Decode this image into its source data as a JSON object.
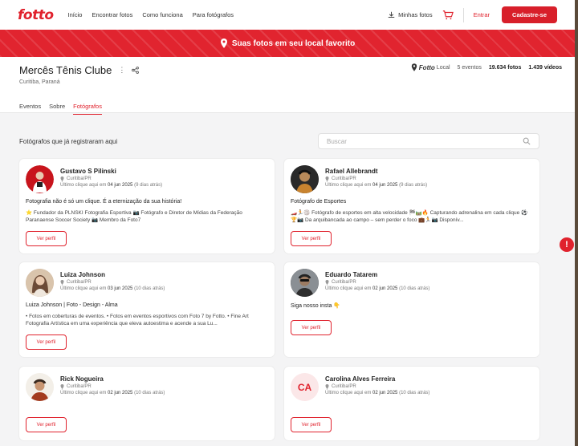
{
  "nav": {
    "logo": "fotto",
    "links": [
      "Início",
      "Encontrar fotos",
      "Como funciona",
      "Para fotógrafos"
    ],
    "my_photos": "Minhas fotos",
    "login": "Entrar",
    "signup": "Cadastre-se"
  },
  "banner": {
    "text": "Suas fotos em seu local favorito"
  },
  "venue": {
    "name": "Mercês Tênis Clube",
    "location": "Curitiba, Paraná",
    "brand": "Fotto",
    "brand_suffix": "Local",
    "events": "5 eventos",
    "photos": "19.634 fotos",
    "videos": "1.439 vídeos"
  },
  "tabs": [
    "Eventos",
    "Sobre",
    "Fotógrafos"
  ],
  "active_tab": "Fotógrafos",
  "section": {
    "title": "Fotógrafos que já registraram aqui",
    "search_placeholder": "Buscar"
  },
  "photographers": [
    {
      "name": "Gustavo S Pilinski",
      "city": "Curitiba/PR",
      "last_click_prefix": "Último clique aqui em",
      "last_click_date": "04 jun 2025",
      "last_click_ago": "(9 dias atrás)",
      "headline": "Fotografia não é só um clique. É a eternização da sua história!",
      "bio": "⭐ Fundador da PLNSKI Fotografia Esportiva 📷 Fotógrafo e Diretor de Mídias da Federação Paranaense Soccer Society 📷 Membro da Foto7",
      "button": "Ver perfil",
      "avatar_colors": [
        "#c8141c",
        "#f2f2f2"
      ]
    },
    {
      "name": "Rafael Allebrandt",
      "city": "Curitiba/PR",
      "last_click_prefix": "Último clique aqui em",
      "last_click_date": "04 jun 2025",
      "last_click_ago": "(9 dias atrás)",
      "headline": "Fotógrafo de Esportes",
      "bio": "🏎️🏃🏐 Fotógrafo de esportes em alta velocidade 🏁🛤️🔥 Capturando adrenalina em cada clique ⚽🏆📷 Da arquibancada ao campo – sem perder o foco 💼🏃📷 Disponív...",
      "button": "Ver perfil",
      "avatar_colors": [
        "#1d1d1d",
        "#b88a5a"
      ]
    },
    {
      "name": "Luiza Johnson",
      "city": "Curitiba/PR",
      "last_click_prefix": "Último clique aqui em",
      "last_click_date": "03 jun 2025",
      "last_click_ago": "(10 dias atrás)",
      "headline": "Luiza Johnson | Foto - Design - Alma",
      "bio": "• Fotos em coberturas de eventos. • Fotos em eventos esportivos com Foto 7 by Fotto. • Fine Art Fotografia Artística em uma experiência que eleva autoestima e acende a sua Lu...",
      "button": "Ver perfil",
      "avatar_colors": [
        "#c9a98a",
        "#6b4a36"
      ]
    },
    {
      "name": "Eduardo Tatarem",
      "city": "Curitiba/PR",
      "last_click_prefix": "Último clique aqui em",
      "last_click_date": "02 jun 2025",
      "last_click_ago": "(10 dias atrás)",
      "headline": "Siga nosso insta 👇",
      "bio": "",
      "button": "Ver perfil",
      "avatar_colors": [
        "#3c3c3c",
        "#9c7b62"
      ]
    },
    {
      "name": "Rick Nogueira",
      "city": "Curitiba/PR",
      "last_click_prefix": "Último clique aqui em",
      "last_click_date": "02 jun 2025",
      "last_click_ago": "(10 dias atrás)",
      "headline": "",
      "bio": "",
      "button": "Ver perfil",
      "avatar_colors": [
        "#f3efe8",
        "#a33b1f"
      ]
    },
    {
      "name": "Carolina Alves Ferreira",
      "city": "Curitiba/PR",
      "last_click_prefix": "Último clique aqui em",
      "last_click_date": "02 jun 2025",
      "last_click_ago": "(10 dias atrás)",
      "headline": "",
      "bio": "",
      "button": "Ver perfil",
      "initials": "CA"
    }
  ],
  "colors": {
    "brand_red": "#e0222d",
    "background": "#f4f4f5"
  },
  "icons": [
    "download-icon",
    "cart-icon",
    "pin-icon",
    "more-icon",
    "share-icon",
    "search-icon",
    "info-icon"
  ]
}
